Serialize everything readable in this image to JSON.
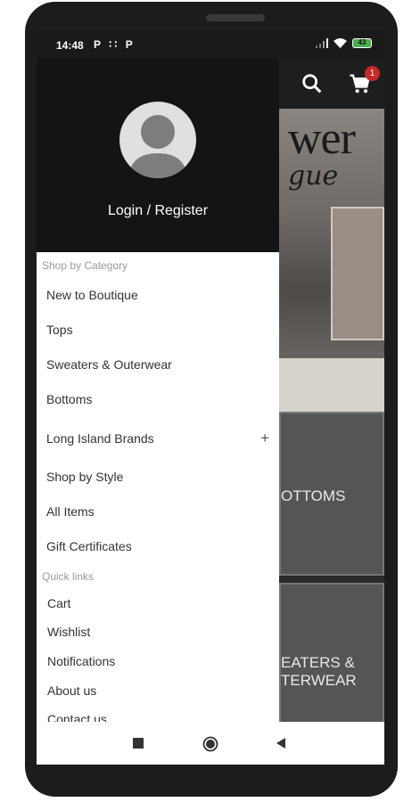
{
  "status_bar": {
    "time": "14:48",
    "notification_icons": "P ∶∶ P",
    "battery": "43"
  },
  "app": {
    "cart_count": "1",
    "banner_logo": "wer",
    "banner_script": "gue",
    "tiles": [
      {
        "label": "OTTOMS"
      },
      {
        "label": "EATERS &\nTERWEAR"
      }
    ]
  },
  "drawer": {
    "login_label": "Login / Register",
    "shop_section_title": "Shop by Category",
    "categories": [
      {
        "label": "New to Boutique"
      },
      {
        "label": "Tops"
      },
      {
        "label": "Sweaters & Outerwear"
      },
      {
        "label": "Bottoms"
      },
      {
        "label": "Long Island Brands",
        "expand_icon": "+"
      },
      {
        "label": "Shop by Style"
      },
      {
        "label": "All Items"
      },
      {
        "label": "Gift Certificates"
      }
    ],
    "quick_section_title": "Quick links",
    "quick_links": [
      {
        "label": "Cart"
      },
      {
        "label": "Wishlist"
      },
      {
        "label": "Notifications"
      },
      {
        "label": "About us"
      },
      {
        "label": "Contact us"
      }
    ]
  },
  "icons": {
    "search": "search-icon",
    "cart": "cart-icon",
    "avatar": "user-avatar-icon",
    "nav_recent": "square-icon",
    "nav_home": "circle-icon",
    "nav_back": "triangle-back-icon"
  }
}
